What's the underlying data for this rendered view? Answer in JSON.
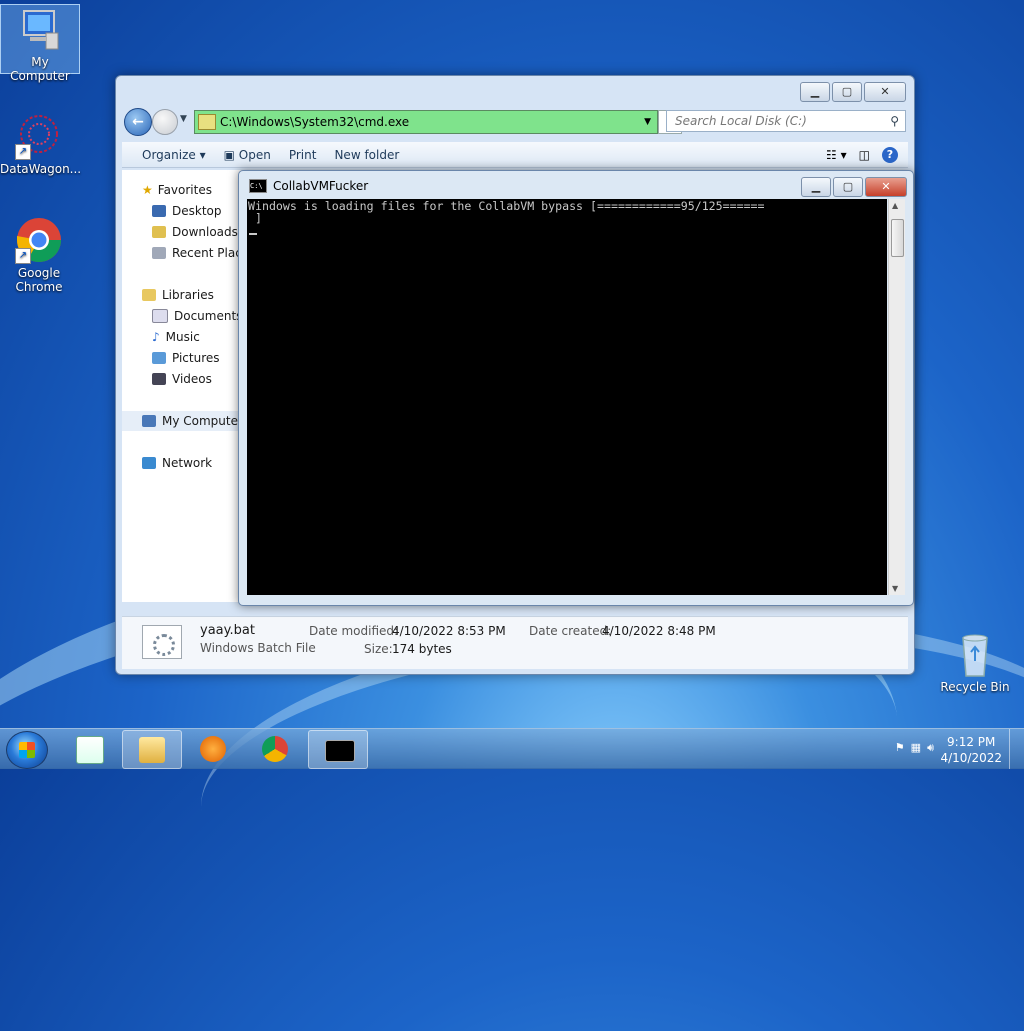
{
  "desktop": {
    "icons": [
      {
        "label": "My Computer"
      },
      {
        "label": "DataWagon..."
      },
      {
        "label": "Google Chrome"
      },
      {
        "label": "Recycle Bin"
      }
    ]
  },
  "explorer": {
    "address": "C:\\Windows\\System32\\cmd.exe",
    "search_placeholder": "Search Local Disk (C:)",
    "toolbar": {
      "organize": "Organize",
      "open": "Open",
      "print": "Print",
      "new_folder": "New folder"
    },
    "nav": {
      "favorites": "Favorites",
      "desktop": "Desktop",
      "downloads": "Downloads",
      "recent": "Recent Places",
      "libraries": "Libraries",
      "documents": "Documents",
      "music": "Music",
      "pictures": "Pictures",
      "videos": "Videos",
      "computer": "My Computer",
      "network": "Network"
    },
    "details": {
      "filename": "yaay.bat",
      "filetype": "Windows Batch File",
      "modified_label": "Date modified:",
      "modified_value": "4/10/2022 8:53 PM",
      "created_label": "Date created:",
      "created_value": "4/10/2022 8:48 PM",
      "size_label": "Size:",
      "size_value": "174 bytes"
    }
  },
  "cmd": {
    "title": "CollabVMFucker",
    "line1": "Windows is loading files for the CollabVM bypass [============95/125======",
    "line2": " ]"
  },
  "taskbar": {
    "time": "9:12 PM",
    "date": "4/10/2022"
  },
  "colors": {
    "address_bar": "#7fe38c",
    "console_bg": "#000000",
    "console_text": "#c8c8c8"
  }
}
